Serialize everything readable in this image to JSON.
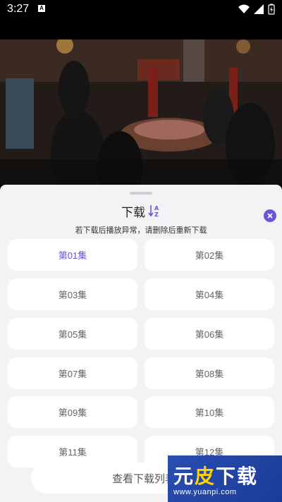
{
  "status_bar": {
    "time": "3:27",
    "app_icon_letter": "A"
  },
  "sheet": {
    "title": "下载",
    "hint": "若下载后播放异常，请删除后重新下载",
    "episodes": [
      "第01集",
      "第02集",
      "第03集",
      "第04集",
      "第05集",
      "第06集",
      "第07集",
      "第08集",
      "第09集",
      "第10集",
      "第11集",
      "第12集"
    ],
    "selected_index": 0,
    "bottom_button": "查看下载列表"
  },
  "watermark": {
    "part1": "元",
    "part2": "皮",
    "part3": "下载",
    "url": "www.yuanpi.com"
  },
  "colors": {
    "accent": "#6a54d8",
    "sheet_bg": "#f3f3f5",
    "watermark_bg": "#1a3a98"
  }
}
